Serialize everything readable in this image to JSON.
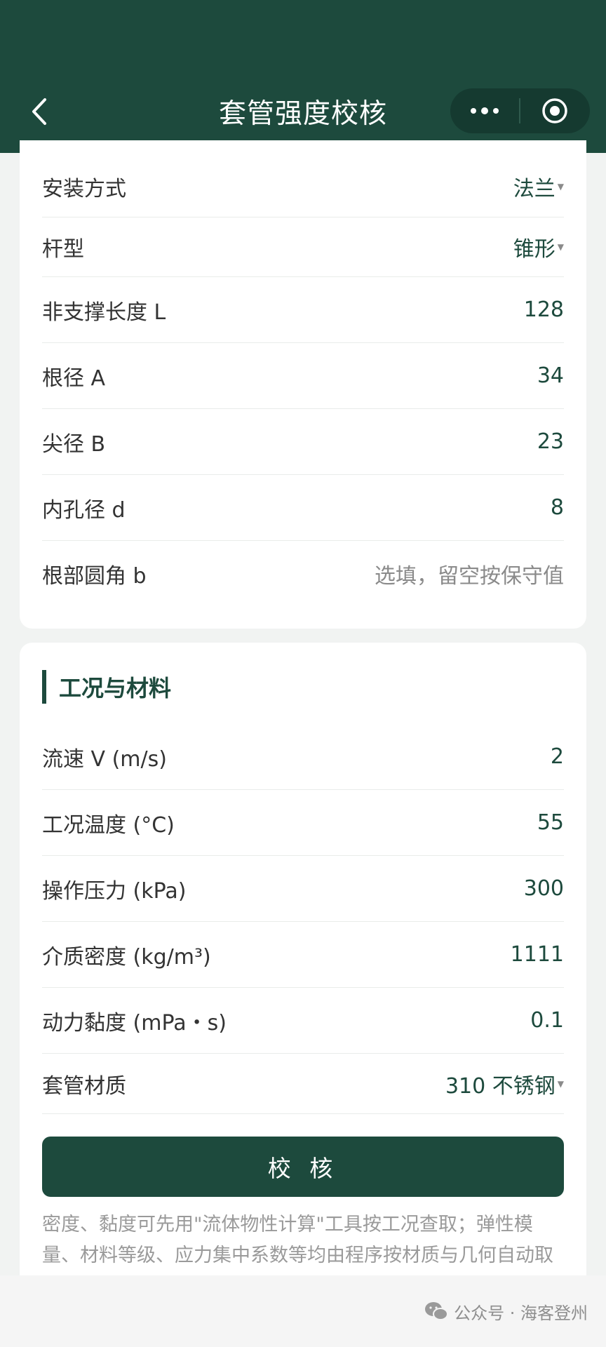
{
  "nav": {
    "title": "套管强度校核"
  },
  "geometry_rows": [
    {
      "label": "安装方式",
      "value": "法兰",
      "dropdown": true
    },
    {
      "label": "杆型",
      "value": "锥形",
      "dropdown": true
    },
    {
      "label": "非支撑长度 L",
      "value": "128"
    },
    {
      "label": "根径 A",
      "value": "34"
    },
    {
      "label": "尖径 B",
      "value": "23"
    },
    {
      "label": "内孔径 d",
      "value": "8"
    },
    {
      "label": "根部圆角 b",
      "placeholder": "选填，留空按保守值"
    }
  ],
  "section": {
    "title": "工况与材料"
  },
  "condition_rows": [
    {
      "label": "流速 V (m/s)",
      "value": "2"
    },
    {
      "label": "工况温度 (°C)",
      "value": "55"
    },
    {
      "label": "操作压力 (kPa)",
      "value": "300"
    },
    {
      "label": "介质密度 (kg/m³)",
      "value": "1111"
    },
    {
      "label": "动力黏度 (mPa・s)",
      "value": "0.1"
    },
    {
      "label": "套管材质",
      "value": "310 不锈钢",
      "dropdown": true
    }
  ],
  "submit_label": "校 核",
  "note": "密度、黏度可先用\"流体物性计算\"工具按工况查取；弹性模量、材料等级、应力集中系数等均由程序按材质与几何自动取值",
  "footer": {
    "text": "公众号 · 海客登州"
  },
  "colors": {
    "brand": "#1d4a3d",
    "background": "#f1f3f2"
  }
}
